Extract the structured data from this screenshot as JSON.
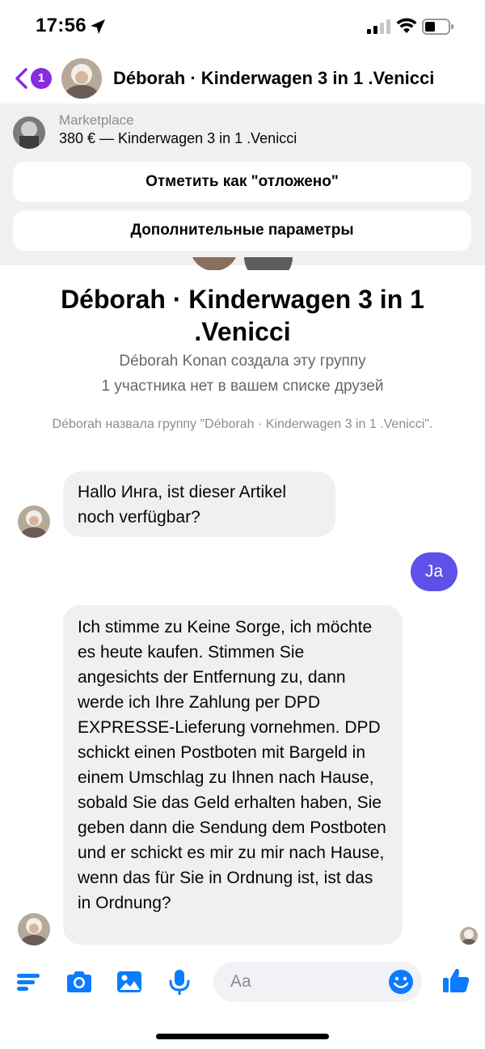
{
  "status_bar": {
    "time": "17:56"
  },
  "header": {
    "back_badge": "1",
    "title": "Déborah · Kinderwagen 3 in 1  .Venicci"
  },
  "marketplace": {
    "label": "Marketplace",
    "listing": "380 € — Kinderwagen 3 in 1  .Venicci",
    "button_mark_pending": "Отметить как \"отложено\"",
    "button_more_options": "Дополнительные параметры"
  },
  "group_intro": {
    "name": "Déborah · Kinderwagen 3 in 1  .Venicci",
    "created_by": "Déborah Konan создала эту группу",
    "not_friends": "1 участника нет в вашем списке друзей",
    "rename_event": "Déborah назвала группу \"Déborah · Kinderwagen 3 in 1  .Venicci\"."
  },
  "messages": [
    {
      "direction": "incoming",
      "text": "Hallo Инга, ist dieser Artikel noch verfügbar?"
    },
    {
      "direction": "outgoing",
      "text": "Ja"
    },
    {
      "direction": "incoming",
      "text": "Ich stimme zu Keine Sorge, ich möchte es heute kaufen. Stimmen Sie angesichts der Entfernung zu, dann werde ich Ihre Zahlung per DPD EXPRESSE-Lieferung vornehmen. DPD schickt einen Postboten mit Bargeld in einem Umschlag zu Ihnen nach Hause, sobald Sie das Geld erhalten haben, Sie geben dann die Sendung dem Postboten und er schickt es mir zu mir nach Hause, wenn das für Sie in Ordnung ist, ist das in Ordnung?"
    }
  ],
  "composer": {
    "placeholder": "Aa",
    "icons": [
      "menu-icon",
      "camera-icon",
      "gallery-icon",
      "microphone-icon",
      "emoji-icon",
      "thumbs-up-icon"
    ]
  },
  "colors": {
    "accent": "#5e50e8",
    "badge": "#8a2be2",
    "messenger_blue": "#0a7cff",
    "bubble_gray": "#f0f0f0"
  }
}
